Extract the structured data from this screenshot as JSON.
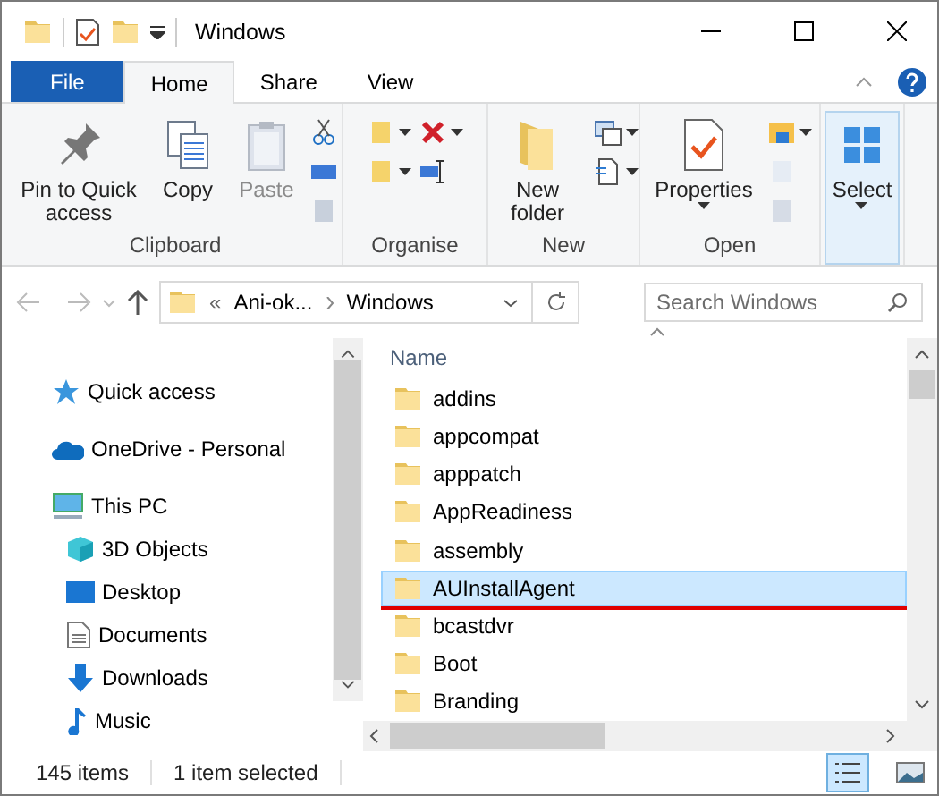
{
  "window": {
    "title": "Windows"
  },
  "tabs": [
    {
      "label": "File",
      "kind": "file",
      "selected": false
    },
    {
      "label": "Home",
      "kind": "tab",
      "selected": true
    },
    {
      "label": "Share",
      "kind": "tab",
      "selected": false
    },
    {
      "label": "View",
      "kind": "tab",
      "selected": false
    }
  ],
  "ribbon": {
    "groups": [
      {
        "label": "Clipboard",
        "buttons": [
          {
            "label": "Pin to Quick access",
            "disabled": false,
            "highlighted": false,
            "dropdown": false
          },
          {
            "label": "Copy",
            "disabled": false,
            "highlighted": false,
            "dropdown": false
          },
          {
            "label": "Paste",
            "disabled": true,
            "highlighted": false,
            "dropdown": false
          }
        ]
      },
      {
        "label": "Organise"
      },
      {
        "label": "New",
        "buttons": [
          {
            "label": "New folder",
            "disabled": false,
            "highlighted": false,
            "dropdown": false
          }
        ]
      },
      {
        "label": "Open",
        "buttons": [
          {
            "label": "Properties",
            "disabled": false,
            "highlighted": false,
            "dropdown": true
          }
        ]
      },
      {
        "buttons": [
          {
            "label": "Select",
            "disabled": false,
            "highlighted": true,
            "dropdown": true
          }
        ]
      }
    ]
  },
  "address": {
    "path": [
      {
        "label": "«"
      },
      {
        "label": "Ani-ok..."
      },
      {
        "label": "Windows"
      }
    ]
  },
  "search": {
    "placeholder": "Search Windows"
  },
  "navigation": [
    {
      "label": "Quick access"
    },
    {
      "label": "OneDrive - Personal"
    },
    {
      "label": "This PC",
      "children": [
        {
          "label": "3D Objects"
        },
        {
          "label": "Desktop"
        },
        {
          "label": "Documents"
        },
        {
          "label": "Downloads"
        },
        {
          "label": "Music"
        }
      ]
    }
  ],
  "files": {
    "columns": [
      "Name"
    ],
    "rows": [
      {
        "name": "addins",
        "selected": false,
        "underlined": false
      },
      {
        "name": "appcompat",
        "selected": false,
        "underlined": false
      },
      {
        "name": "apppatch",
        "selected": false,
        "underlined": false
      },
      {
        "name": "AppReadiness",
        "selected": false,
        "underlined": false
      },
      {
        "name": "assembly",
        "selected": false,
        "underlined": false
      },
      {
        "name": "AUInstallAgent",
        "selected": true,
        "underlined": true
      },
      {
        "name": "bcastdvr",
        "selected": false,
        "underlined": false
      },
      {
        "name": "Boot",
        "selected": false,
        "underlined": false
      },
      {
        "name": "Branding",
        "selected": false,
        "underlined": false
      }
    ]
  },
  "status_bar": {
    "items": [
      "145 items",
      "1 item selected"
    ],
    "details_view": true
  }
}
